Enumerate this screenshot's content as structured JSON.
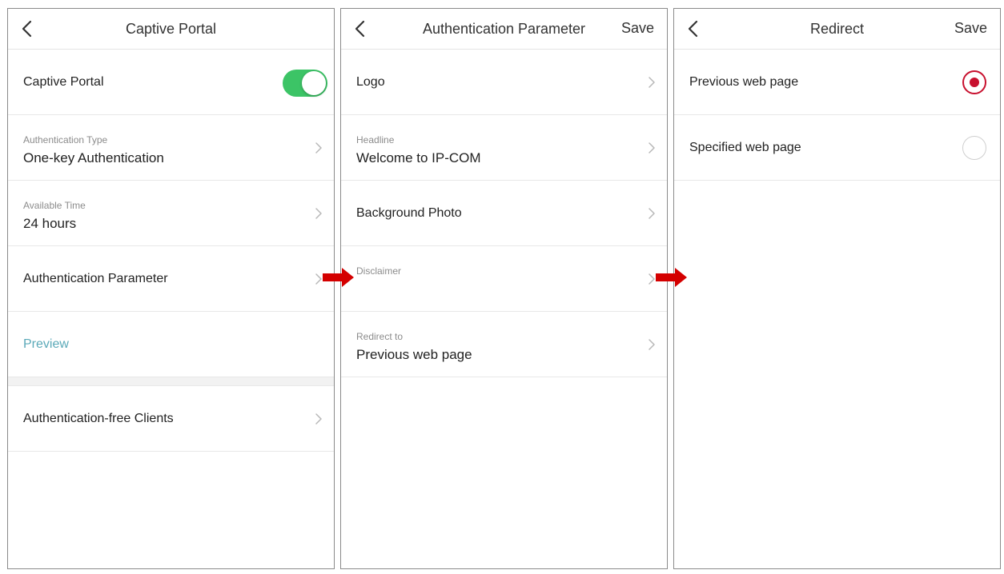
{
  "captive_portal_screen": {
    "title": "Captive Portal",
    "toggle_label": "Captive Portal",
    "toggle_state": "on",
    "auth_type_label": "Authentication Type",
    "auth_type_value": "One-key Authentication",
    "available_time_label": "Available Time",
    "available_time_value": "24 hours",
    "auth_param_label": "Authentication Parameter",
    "preview_label": "Preview",
    "auth_free_clients_label": "Authentication-free Clients"
  },
  "auth_parameter_screen": {
    "title": "Authentication Parameter",
    "save_label": "Save",
    "logo_label": "Logo",
    "headline_label": "Headline",
    "headline_value": "Welcome to IP-COM",
    "background_photo_label": "Background Photo",
    "disclaimer_label": "Disclaimer",
    "redirect_label": "Redirect to",
    "redirect_value": "Previous web page"
  },
  "redirect_screen": {
    "title": "Redirect",
    "save_label": "Save",
    "options": [
      {
        "label": "Previous web page",
        "selected": true
      },
      {
        "label": "Specified web page",
        "selected": false
      }
    ]
  },
  "colors": {
    "toggle_on": "#3cc466",
    "radio_selected": "#c8102e",
    "arrow": "#d40000",
    "preview_link": "#5aa9b8"
  },
  "icons": [
    "back-chevron-icon",
    "chevron-right-icon",
    "red-arrow-icon"
  ]
}
